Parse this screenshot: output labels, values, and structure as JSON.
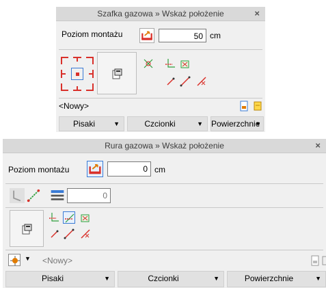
{
  "panel1": {
    "title": "Szafka gazowa » Wskaż położenie",
    "close_glyph": "×",
    "level_label": "Poziom montażu",
    "level_value": "50",
    "unit": "cm",
    "name_value": "<Nowy>",
    "dropdowns": [
      "Pisaki",
      "Czcionki",
      "Powierzchnie"
    ]
  },
  "panel2": {
    "title": "Rura gazowa » Wskaż położenie",
    "close_glyph": "×",
    "level_label": "Poziom montażu",
    "level_value": "0",
    "unit": "cm",
    "count_value": "0",
    "name_value": "<Nowy>",
    "dropdowns": [
      "Pisaki",
      "Czcionki",
      "Powierzchnie"
    ]
  },
  "colors": {
    "accent_blue": "#3a7bd5",
    "icon_red": "#d9302a",
    "icon_green": "#2e9e3c",
    "icon_orange": "#e07b00"
  }
}
